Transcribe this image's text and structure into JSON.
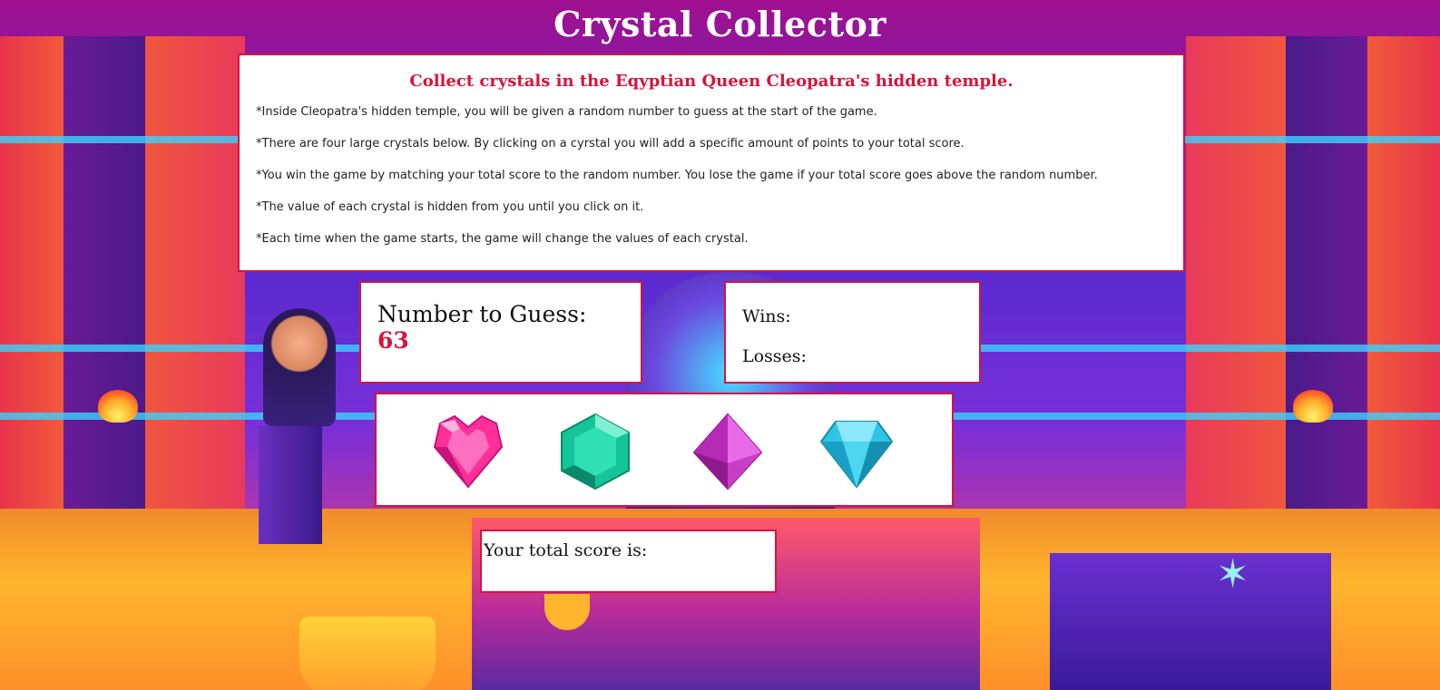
{
  "title": "Crystal Collector",
  "instructions": {
    "heading": "Collect crystals in the Eqyptian Queen Cleopatra's hidden temple.",
    "lines": [
      "*Inside Cleopatra's hidden temple, you will be given a random number to guess at the start of the game.",
      "*There are four large crystals below. By clicking on a cyrstal you will add a specific amount of points to your total score.",
      "*You win the game by matching your total score to the random number. You lose the game if your total score goes above the random number.",
      "*The value of each crystal is hidden from you until you click on it.",
      "*Each time when the game starts, the game will change the values of each crystal."
    ]
  },
  "guess": {
    "label": "Number to Guess: ",
    "value": "63"
  },
  "stats": {
    "wins_label": "Wins:",
    "losses_label": "Losses:"
  },
  "crystals": [
    {
      "icon": "pink-heart-crystal-icon",
      "color": "#ff2f9a"
    },
    {
      "icon": "green-hexagon-crystal-icon",
      "color": "#16c49a"
    },
    {
      "icon": "magenta-octahedron-crystal-icon",
      "color": "#d640d6"
    },
    {
      "icon": "cyan-diamond-crystal-icon",
      "color": "#2fc6e6"
    }
  ],
  "score": {
    "label": "Your total score is:"
  },
  "colors": {
    "accent": "#d6143c",
    "panel": "#ffffff"
  }
}
